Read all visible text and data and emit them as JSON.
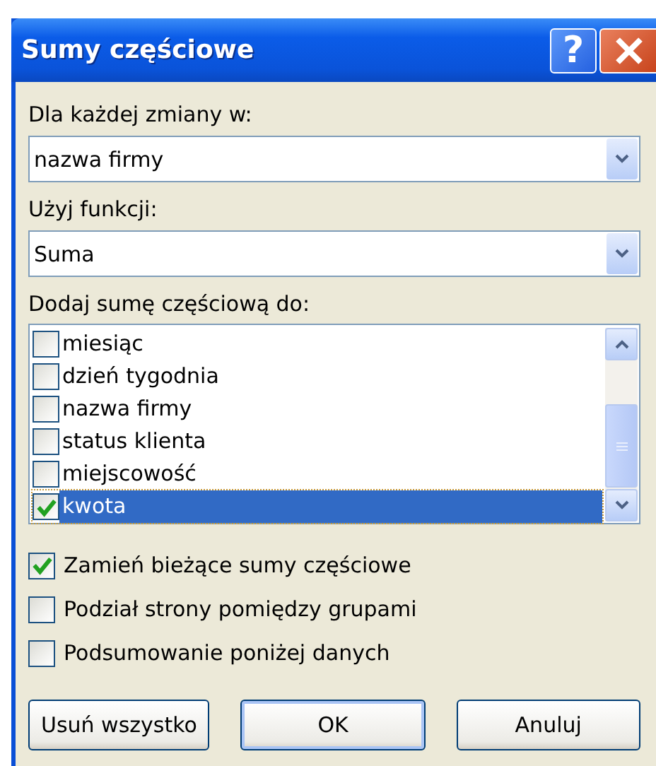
{
  "window": {
    "title": "Sumy częściowe",
    "help_button": "?"
  },
  "group_by": {
    "label": "Dla każdej zmiany w:",
    "value": "nazwa firmy"
  },
  "function": {
    "label": "Użyj funkcji:",
    "value": "Suma"
  },
  "add_subtotal_to": {
    "label": "Dodaj sumę częściową do:",
    "items": [
      {
        "label": "miesiąc",
        "checked": false,
        "selected": false
      },
      {
        "label": "dzień tygodnia",
        "checked": false,
        "selected": false
      },
      {
        "label": "nazwa firmy",
        "checked": false,
        "selected": false
      },
      {
        "label": "status klienta",
        "checked": false,
        "selected": false
      },
      {
        "label": "miejscowość",
        "checked": false,
        "selected": false
      },
      {
        "label": "kwota",
        "checked": true,
        "selected": true
      }
    ]
  },
  "options": [
    {
      "label": "Zamień bieżące sumy częściowe",
      "checked": true
    },
    {
      "label": "Podział strony pomiędzy grupami",
      "checked": false
    },
    {
      "label": "Podsumowanie poniżej danych",
      "checked": false
    }
  ],
  "buttons": [
    {
      "label": "Usuń wszystko",
      "default": false
    },
    {
      "label": "OK",
      "default": true
    },
    {
      "label": "Anuluj",
      "default": false
    }
  ]
}
